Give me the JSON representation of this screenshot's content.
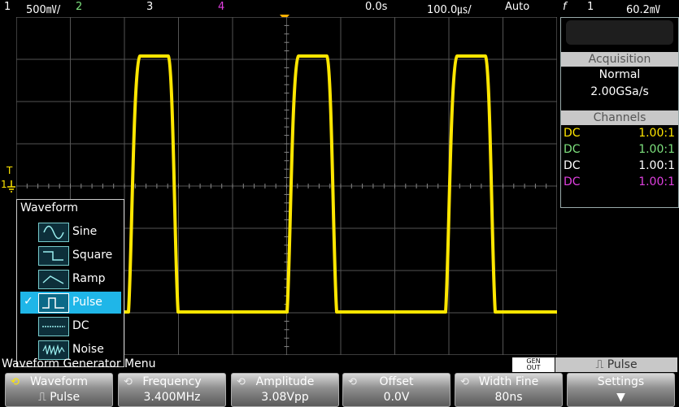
{
  "topbar": {
    "ch1_num": "1",
    "ch1_scale": "500㎷/",
    "ch2_num": "2",
    "ch3_num": "3",
    "ch4_num": "4",
    "time_delay": "0.0s",
    "time_scale": "100.0㎲/",
    "trigger_mode": "Auto",
    "trigger_icon": "f",
    "trigger_ch": "1",
    "trigger_level": "60.2㎷"
  },
  "colors": {
    "ch1": "#ffe600",
    "ch2": "#7ee27e",
    "ch3": "#ffffff",
    "ch4": "#e040e0",
    "highlight": "#1fb6e8"
  },
  "acquisition": {
    "header": "Acquisition",
    "mode": "Normal",
    "rate": "2.00GSa/s"
  },
  "channels": {
    "header": "Channels",
    "rows": [
      {
        "coupling": "DC",
        "ratio": "1.00:1"
      },
      {
        "coupling": "DC",
        "ratio": "1.00:1"
      },
      {
        "coupling": "DC",
        "ratio": "1.00:1"
      },
      {
        "coupling": "DC",
        "ratio": "1.00:1"
      }
    ]
  },
  "markers": {
    "ground": "1",
    "trigger": "T"
  },
  "waveform_menu": {
    "title": "Waveform",
    "items": [
      {
        "label": "Sine",
        "icon": "sine-icon"
      },
      {
        "label": "Square",
        "icon": "square-wave-icon"
      },
      {
        "label": "Ramp",
        "icon": "ramp-icon"
      },
      {
        "label": "Pulse",
        "icon": "pulse-icon",
        "selected": true
      },
      {
        "label": "DC",
        "icon": "dc-icon"
      },
      {
        "label": "Noise",
        "icon": "noise-icon"
      }
    ],
    "check": "✓"
  },
  "menu_title": "Waveform Generator Menu",
  "gen_out": {
    "line1": "GEN",
    "line2": "OUT",
    "label": "⎍ Pulse"
  },
  "softkeys": [
    {
      "label": "Waveform",
      "value": "⎍ Pulse",
      "knob": "⟲",
      "active": true
    },
    {
      "label": "Frequency",
      "value": "3.400MHz",
      "knob": "⟲"
    },
    {
      "label": "Amplitude",
      "value": "3.08Vpp",
      "knob": "⟲"
    },
    {
      "label": "Offset",
      "value": "0.0V",
      "knob": "⟲"
    },
    {
      "label": "Width Fine",
      "value": "80ns",
      "knob": "⟲"
    },
    {
      "label": "Settings",
      "value": "▼"
    }
  ]
}
